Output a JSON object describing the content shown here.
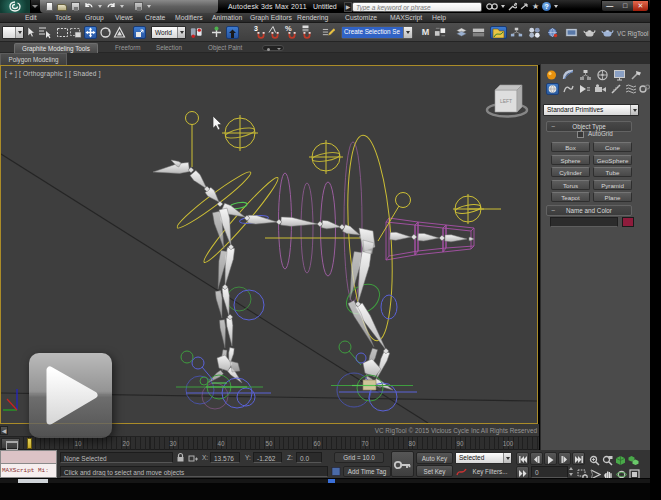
{
  "titlebar": {
    "app_name": "3ds Max",
    "title": "Autodesk 3ds Max  2011",
    "document": "Untitled",
    "search_placeholder": "Type a keyword or phrase",
    "minimize": "—",
    "maximize": "□",
    "close": "✕",
    "help": "?"
  },
  "menubar": {
    "items": [
      "Edit",
      "Tools",
      "Group",
      "Views",
      "Create",
      "Modifiers",
      "Animation",
      "Graph Editors",
      "Rendering",
      "Customize",
      "MAXScript",
      "Help"
    ]
  },
  "toolbar": {
    "coord_system": "World",
    "selection_set": "Create Selection Se",
    "snap_3d": "3",
    "percent": "%",
    "mirror": "M",
    "rigtool": "VC RigTool"
  },
  "ribbon": {
    "active_tab": "Graphite Modeling Tools",
    "tabs": [
      "Freeform",
      "Selection",
      "Object Paint"
    ],
    "panel_tab": "Polygon Modeling"
  },
  "viewport": {
    "label": "[ + ] [ Orthographic ] [ Shaded ]",
    "watermark": "VC RigTool © 2015 Vicious Cycle Inc  All Rights Reserved",
    "viewcube_face": "LEFT"
  },
  "command_panel": {
    "dropdown": "Standard Primitives",
    "rollout_object_type": "Object Type",
    "rollout_name_color": "Name and Color",
    "autogrid": "AutoGrid",
    "buttons": [
      "Box",
      "Cone",
      "Sphere",
      "GeoSphere",
      "Cylinder",
      "Tube",
      "Torus",
      "Pyramid",
      "Teapot",
      "Plane"
    ],
    "name_value": "",
    "swatch_color": "#8e1c3c"
  },
  "timeline": {
    "tick_labels": [
      "10",
      "20",
      "30",
      "40",
      "50",
      "60",
      "70",
      "80",
      "90",
      "100"
    ],
    "current_frame": "0"
  },
  "statusbar": {
    "maxscript_text": "MAXScript Mi:",
    "selection_text": "None Selected",
    "x_label": "X:",
    "x_value": "13.576",
    "y_label": "Y:",
    "y_value": "-1.262",
    "z_label": "Z:",
    "z_value": "0.0",
    "grid_text": "Grid = 10.0",
    "prompt": "Click and drag to select and move objects",
    "add_time_tag": "Add Time Tag",
    "auto_key": "Auto Key",
    "set_key": "Set Key",
    "selected_combo": "Selected",
    "key_filters": "Key Filters...",
    "frame_field": "0"
  }
}
